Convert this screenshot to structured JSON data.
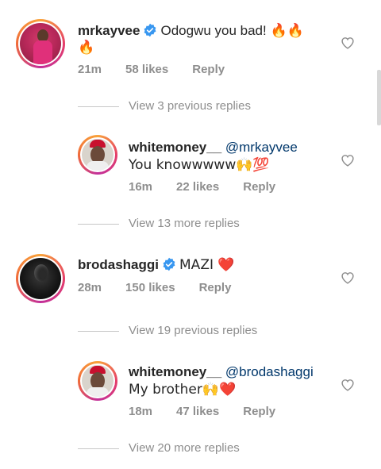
{
  "comments": [
    {
      "username": "mrkayvee",
      "verified": true,
      "text": "Odogwu you bad! 🔥🔥",
      "text_cont": "🔥",
      "time": "21m",
      "likes": "58 likes",
      "reply": "Reply",
      "view_replies": "View 3 previous replies",
      "replies": [
        {
          "username": "whitemoney__",
          "mention": "@mrkayvee",
          "text": "You knowwwww🙌💯",
          "time": "16m",
          "likes": "22 likes",
          "reply": "Reply",
          "view_more": "View 13 more replies"
        }
      ]
    },
    {
      "username": "brodashaggi",
      "verified": true,
      "text": "MAZI ❤️",
      "time": "28m",
      "likes": "150 likes",
      "reply": "Reply",
      "view_replies": "View 19 previous replies",
      "replies": [
        {
          "username": "whitemoney__",
          "mention": "@brodashaggi",
          "text": "My brother🙌❤️",
          "time": "18m",
          "likes": "47 likes",
          "reply": "Reply",
          "view_more": "View 20 more replies"
        }
      ]
    }
  ],
  "colors": {
    "text": "#262626",
    "secondary": "#8e8e8e",
    "mention": "#00376b",
    "verified": "#3897f0",
    "heart_outline": "#8e8e8e"
  },
  "icons": [
    "verified-badge-icon",
    "heart-outline-icon"
  ]
}
